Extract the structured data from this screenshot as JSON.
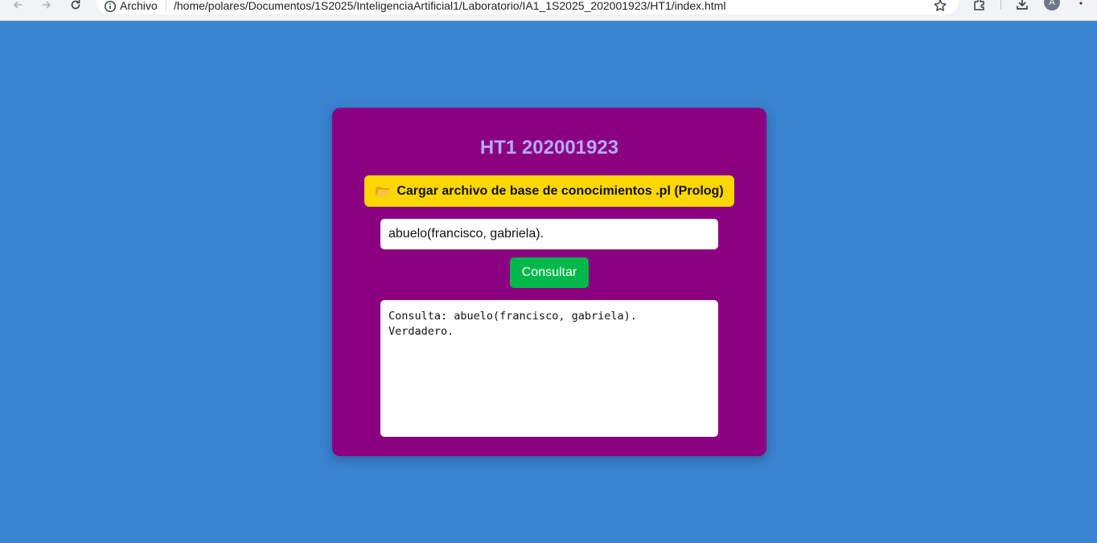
{
  "browser": {
    "scheme_label": "Archivo",
    "url": "/home/polares/Documentos/1S2025/InteligenciaArtificial1/Laboratorio/IA1_1S2025_202001923/HT1/index.html",
    "avatar_initial": "A"
  },
  "app": {
    "title": "HT1 202001923",
    "load_button_label": "Cargar archivo de base de conocimientos .pl (Prolog)",
    "query_value": "abuelo(francisco, gabriela).",
    "consult_button_label": "Consultar",
    "result_text": "Consulta: abuelo(francisco, gabriela).\nVerdadero."
  },
  "colors": {
    "page_background": "#3a83d0",
    "card_background": "#8b0080",
    "title_color": "#b5a9ff",
    "load_button": "#ffd700",
    "consult_button": "#00b84a"
  },
  "icons": {
    "load_button_icon": "open-folder-icon"
  }
}
